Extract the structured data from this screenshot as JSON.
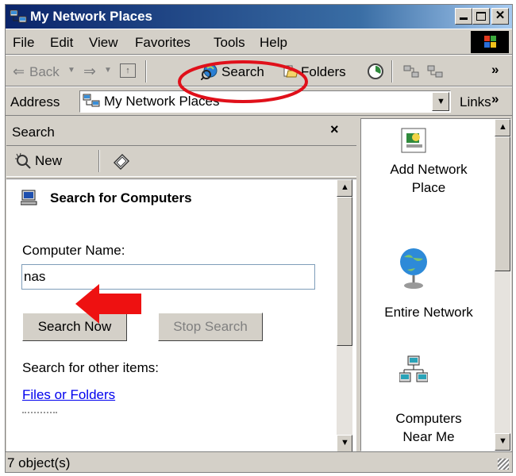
{
  "window": {
    "title": "My Network Places"
  },
  "menu": {
    "items": [
      "File",
      "Edit",
      "View",
      "Favorites",
      "Tools",
      "Help"
    ]
  },
  "toolbar": {
    "back": "Back",
    "search": "Search",
    "folders": "Folders"
  },
  "address": {
    "label": "Address",
    "value": "My Network Places",
    "links": "Links"
  },
  "search_pane": {
    "title": "Search",
    "new_label": "New",
    "heading": "Search for Computers",
    "computer_name_label": "Computer Name:",
    "computer_name_value": "nas",
    "search_now": "Search Now",
    "stop_search": "Stop Search",
    "other_items_label": "Search for other items:",
    "files_link": "Files or Folders"
  },
  "items": [
    {
      "icon": "network-place-icon",
      "label1": "Add Network",
      "label2": "Place"
    },
    {
      "icon": "globe-icon",
      "label1": "Entire Network",
      "label2": ""
    },
    {
      "icon": "computers-icon",
      "label1": "Computers",
      "label2": "Near Me"
    }
  ],
  "status": {
    "text": "7 object(s)"
  },
  "colors": {
    "titlebar_start": "#0a246a",
    "titlebar_end": "#a6caf0",
    "highlight_circle": "#e0101a",
    "arrow": "#ee1111",
    "link": "#0000ee"
  }
}
